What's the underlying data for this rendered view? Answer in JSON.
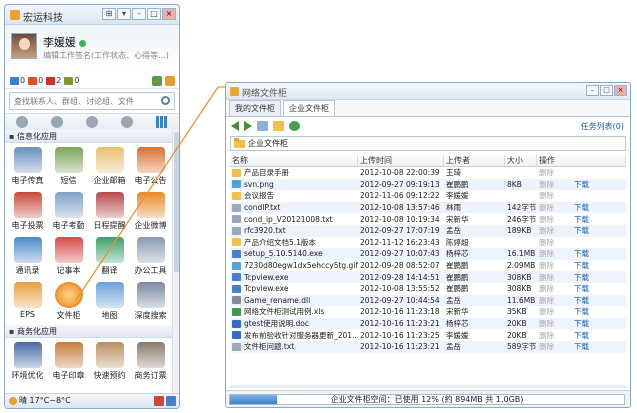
{
  "im": {
    "title": "宏运科技",
    "win_buttons": [
      "⊞",
      "▾",
      "–",
      "□",
      "×"
    ],
    "user_name": "李媛媛",
    "signature": "编辑工作签名(工作状态、心得等...)",
    "counters": [
      {
        "value": "0",
        "color": "#3a7fd0"
      },
      {
        "value": "0",
        "color": "#e0502a"
      },
      {
        "value": "2",
        "color": "#d03030"
      },
      {
        "value": "0",
        "color": "#7a9a30"
      }
    ],
    "search_placeholder": "查找联系人、群组、讨论组、文件",
    "sections": [
      {
        "title": "信息化应用",
        "apps": [
          {
            "label": "电子传真",
            "color": "#6a8fc0"
          },
          {
            "label": "短信",
            "color": "#7aa35a"
          },
          {
            "label": "企业邮箱",
            "color": "#e8c070"
          },
          {
            "label": "电子公告",
            "color": "#d87030"
          },
          {
            "label": "电子投票",
            "color": "#c84a3a"
          },
          {
            "label": "电子考勤",
            "color": "#7ea0c8"
          },
          {
            "label": "日程提醒",
            "color": "#b84a4a"
          },
          {
            "label": "企业微博",
            "color": "#e88a2a"
          },
          {
            "label": "通讯录",
            "color": "#4a8ac8"
          },
          {
            "label": "记事本",
            "color": "#d84a4a"
          },
          {
            "label": "翻译",
            "color": "#3aa06a"
          },
          {
            "label": "办公工具",
            "color": "#8a9ab0"
          },
          {
            "label": "EPS",
            "color": "#e8a040"
          },
          {
            "label": "文件柜",
            "color": "#f0a040"
          },
          {
            "label": "地图",
            "color": "#6aa0d8"
          },
          {
            "label": "深度搜索",
            "color": "#7a8aa0"
          }
        ]
      },
      {
        "title": "商务化应用",
        "apps": [
          {
            "label": "环境优化",
            "color": "#4a6aa8"
          },
          {
            "label": "电子印章",
            "color": "#c87a3a"
          },
          {
            "label": "快速预约",
            "color": "#b89060"
          },
          {
            "label": "商务订票",
            "color": "#8a7a6a"
          }
        ]
      }
    ],
    "weather": "晴 17°C~8°C"
  },
  "fw": {
    "title": "网络文件柜",
    "tabs": [
      "我的文件柜",
      "企业文件柜"
    ],
    "task_list": "任务列表(0)",
    "path": "企业文件柜",
    "columns": [
      "名称",
      "上传时间",
      "上传者",
      "大小",
      "操作"
    ],
    "delete_label": "删除",
    "download_label": "下载",
    "rows": [
      {
        "name": "产品目录手册",
        "time": "2012-10-08 22:00:39",
        "user": "王琦",
        "size": "",
        "type": "folder"
      },
      {
        "name": "svn.png",
        "time": "2012-09-27 09:19:13",
        "user": "崔鹏鹏",
        "size": "8KB",
        "type": "image"
      },
      {
        "name": "会议报告",
        "time": "2012-11-06 09:12:22",
        "user": "李媛媛",
        "size": "",
        "type": "folder"
      },
      {
        "name": "condIP.txt",
        "time": "2012-10-08 13:57:46",
        "user": "林雨",
        "size": "142字节",
        "type": "text"
      },
      {
        "name": "cond_ip_V20121008.txt",
        "time": "2012-10-08 10:19:34",
        "user": "宋新华",
        "size": "246字节",
        "type": "text"
      },
      {
        "name": "rfc3920.txt",
        "time": "2012-09-27 17:07:19",
        "user": "孟岳",
        "size": "189KB",
        "type": "text"
      },
      {
        "name": "产品介绍文档5.1版本",
        "time": "2012-11-12 16:23:43",
        "user": "陈婷超",
        "size": "",
        "type": "folder"
      },
      {
        "name": "setup_5.10.5140.exe",
        "time": "2012-09-27 10:07:43",
        "user": "杨梓芯",
        "size": "16.1MB",
        "type": "exe"
      },
      {
        "name": "7230d80egw1dx5ehccy5tg.gif",
        "time": "2012-09-28 08:52:07",
        "user": "崔鹏鹏",
        "size": "2.09MB",
        "type": "image"
      },
      {
        "name": "Tcpview.exe",
        "time": "2012-09-28 14:14:51",
        "user": "崔鹏鹏",
        "size": "308KB",
        "type": "exe"
      },
      {
        "name": "Tcpview.exe",
        "time": "2012-10-08 13:55:52",
        "user": "崔鹏鹏",
        "size": "308KB",
        "type": "exe"
      },
      {
        "name": "Game_rename.dll",
        "time": "2012-09-27 10:44:54",
        "user": "孟岳",
        "size": "11.6MB",
        "type": "dll"
      },
      {
        "name": "网络文件柜测试用例.xls",
        "time": "2012-10-16 11:23:18",
        "user": "宋新华",
        "size": "35KB",
        "type": "xls"
      },
      {
        "name": "gtest使用说明.doc",
        "time": "2012-10-16 11:23:21",
        "user": "杨梓芯",
        "size": "20KB",
        "type": "doc"
      },
      {
        "name": "发布前验收针对服务器更新_201...",
        "time": "2012-10-16 11:23:25",
        "user": "李媛媛",
        "size": "20KB",
        "type": "doc"
      },
      {
        "name": "文件柜问题.txt",
        "time": "2012-10-16 11:23:21",
        "user": "孟岳",
        "size": "589字节",
        "type": "text"
      }
    ],
    "quota_text": "企业文件柜空间：已使用 12% (約 894MB 共 1.0GB)",
    "quota_used": 0.12
  },
  "colors": {
    "folder": "#f0c04a",
    "image": "#5aa0d8",
    "text": "#9aa8b8",
    "exe": "#4a7fc8",
    "dll": "#8a8aa0",
    "xls": "#3a9a4a",
    "doc": "#3a6ac8"
  }
}
